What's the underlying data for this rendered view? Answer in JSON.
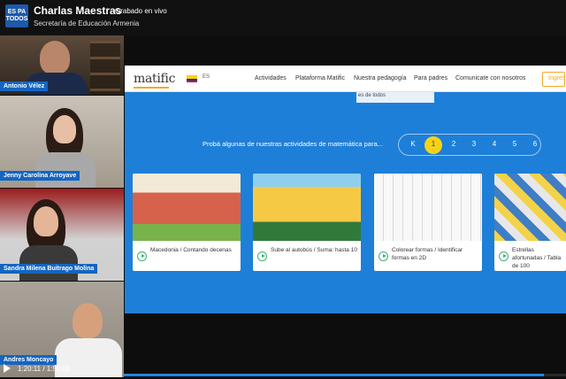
{
  "header": {
    "logo_text": "ES PA TODOS",
    "channel_title": "Charlas Maestras",
    "live_label": "Grabado en vivo",
    "subtitle": "Secretaría de Educación Armenia"
  },
  "participants": [
    {
      "name": "Antonio Vélez"
    },
    {
      "name": "Jenny Carolina Arroyave"
    },
    {
      "name": "Sandra Milena Buitrago Molina"
    },
    {
      "name": "Andres Moncayo"
    }
  ],
  "screen": {
    "brand": "matific",
    "lang": "ES",
    "nav": [
      "Actividades",
      "Plataforma Matific",
      "Nuestra pedagogía",
      "Para padres",
      "Comunicate con nosotros"
    ],
    "login_label": "Ingres",
    "partial_text": "es de todos",
    "prompt": "Probá algunas de nuestras actividades de matemática para...",
    "grades": [
      "K",
      "1",
      "2",
      "3",
      "4",
      "5",
      "6"
    ],
    "active_grade": "1",
    "cards": [
      {
        "title": "Macedonia / Contando decenas"
      },
      {
        "title": "Sube al autobús / Suma: hasta 10"
      },
      {
        "title": "Colorear formas / Identificar formas en 2D"
      },
      {
        "title": "Estrellas afortunadas / Tabla de 100"
      }
    ]
  },
  "player": {
    "time": "1:20:11 / 1:50:00",
    "progress": 0.95
  }
}
